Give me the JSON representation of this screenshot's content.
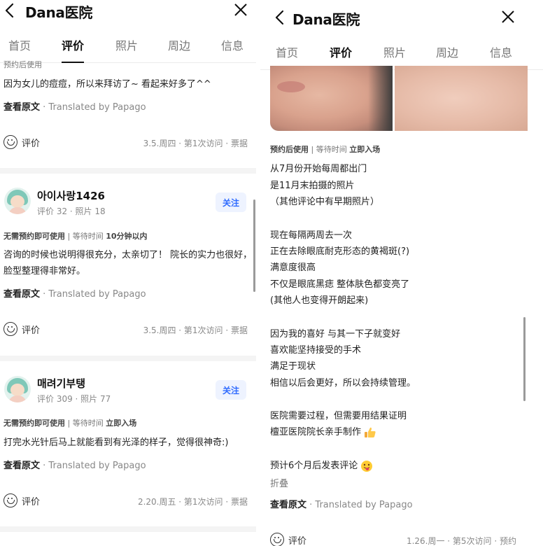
{
  "left": {
    "header": {
      "title": "Dana医院"
    },
    "tabs": [
      "首页",
      "评价",
      "照片",
      "周边",
      "信息"
    ],
    "top_review": {
      "tag": "预约后使用",
      "text": "因为女儿的痘痘，所以来拜访了~ 看起来好多了^^",
      "view_original": "查看原文",
      "translated": " · Translated by Papago",
      "react_label": "评价",
      "meta": "3.5.周四 · 第1次访问 · 票据"
    },
    "reviews": [
      {
        "username": "아이사랑1426",
        "stats": "评价 32 · 照片 18",
        "follow": "关注",
        "tag_prefix": "无需预约即可使用",
        "tag_sep": " | ",
        "tag_wait": "等待时间 ",
        "tag_wait_value": "10分钟以内",
        "text1": "咨询的时候也说明得很充分，太亲切了！ 院长的实力也很好，",
        "text2": "脸型整理得非常好。",
        "view_original": "查看原文",
        "translated": " · Translated by Papago",
        "react_label": "评价",
        "meta": "3.5.周四 · 第1次访问 · 票据"
      },
      {
        "username": "매려기부탱",
        "stats": "评价 309 · 照片 77",
        "follow": "关注",
        "tag_prefix": "无需预约即可使用",
        "tag_sep": " | ",
        "tag_wait": "等待时间 ",
        "tag_wait_value": "立即入场",
        "text1": "打完水光针后马上就能看到有光泽的样子，觉得很神奇:)",
        "view_original": "查看原文",
        "translated": " · Translated by Papago",
        "react_label": "评价",
        "meta": "2.20.周五 · 第1次访问 · 票据"
      }
    ]
  },
  "right": {
    "header": {
      "title": "Dana医院"
    },
    "tabs": [
      "首页",
      "评价",
      "照片",
      "周边",
      "信息"
    ],
    "review": {
      "tag_prefix": "预约后使用",
      "tag_sep": " | ",
      "tag_wait": "等待时间 ",
      "tag_wait_value": "立即入场",
      "lines": [
        "从7月份开始每周都出门",
        "是11月末拍摄的照片",
        "（其他评论中有早期照片）",
        "现在每隔两周去一次",
        "正在去除眼底耐克形态的黄褐斑(?)",
        "满意度很高",
        "不仅是眼底黑痣 整体肤色都变亮了",
        "(其他人也变得开朗起来)",
        "因为我的喜好 与其一下子就变好",
        "喜欢能坚持接受的手术",
        "满足于现状",
        "相信以后会更好，所以会持续管理。",
        "医院需要过程，但需要用结果证明",
        "檀亚医院院长亲手制作",
        "预计6个月后发表评论"
      ],
      "fold": "折叠",
      "view_original": "查看原文",
      "translated": " · Translated by Papago",
      "react_label": "评价",
      "meta": "1.26.周一 · 第5次访问 · 预约"
    }
  }
}
